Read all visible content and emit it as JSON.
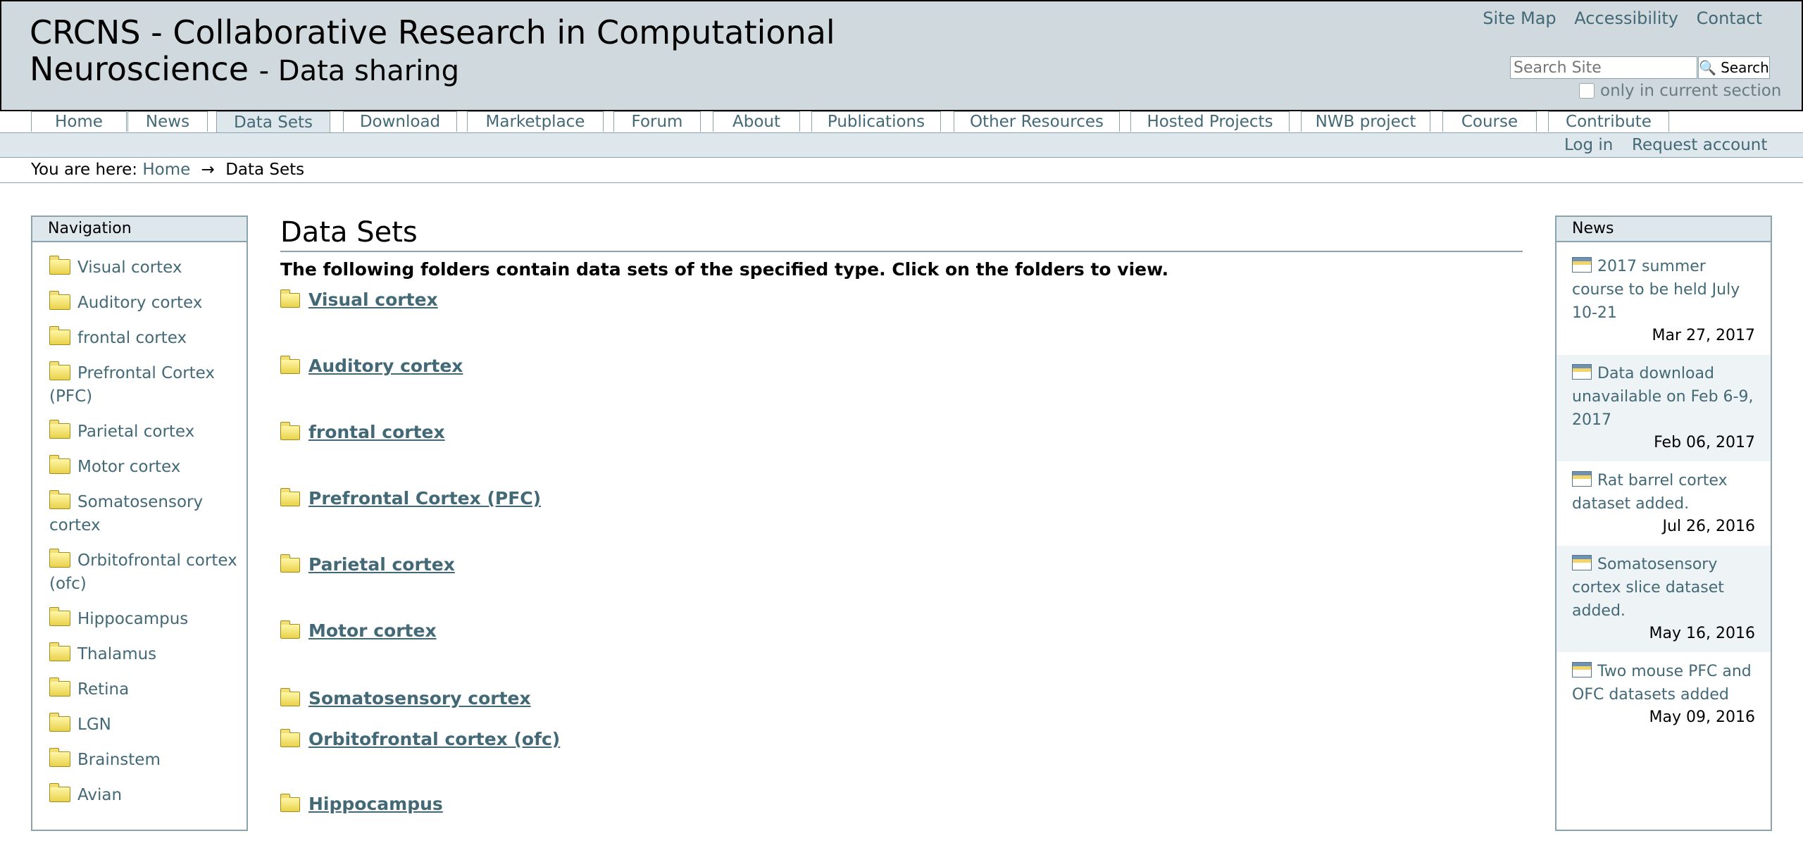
{
  "header": {
    "title_main": "CRCNS - Collaborative Research in Computational Neuroscience",
    "title_sub": "- Data sharing",
    "site_actions": [
      "Site Map",
      "Accessibility",
      "Contact"
    ],
    "search_placeholder": "Search Site",
    "search_button": "Search",
    "search_section_label": "only in current section"
  },
  "tabs": [
    "Home",
    "News",
    "Data Sets",
    "Download",
    "Marketplace",
    "Forum",
    "About",
    "Publications",
    "Other Resources",
    "Hosted Projects",
    "NWB project",
    "Course",
    "Contribute"
  ],
  "personal_bar": {
    "login": "Log in",
    "request": "Request account"
  },
  "breadcrumbs": {
    "prefix": "You are here:",
    "home": "Home",
    "separator": "→",
    "current": "Data Sets"
  },
  "navigation": {
    "header": "Navigation",
    "items": [
      "Visual cortex",
      "Auditory cortex",
      "frontal cortex",
      "Prefrontal Cortex (PFC)",
      "Parietal cortex",
      "Motor cortex",
      "Somatosensory cortex",
      "Orbitofrontal cortex (ofc)",
      "Hippocampus",
      "Thalamus",
      "Retina",
      "LGN",
      "Brainstem",
      "Avian"
    ]
  },
  "content": {
    "title": "Data Sets",
    "description": "The following folders contain data sets of the specified type. Click on the folders to view.",
    "folders": [
      "Visual cortex",
      "Auditory cortex",
      "frontal cortex",
      "Prefrontal Cortex (PFC)",
      "Parietal cortex",
      "Motor cortex",
      "Somatosensory cortex",
      "Orbitofrontal cortex (ofc)",
      "Hippocampus"
    ]
  },
  "news": {
    "header": "News",
    "items": [
      {
        "title": "2017 summer course to be held July 10-21",
        "date": "Mar 27, 2017"
      },
      {
        "title": "Data download unavailable on Feb 6-9, 2017",
        "date": "Feb 06, 2017"
      },
      {
        "title": "Rat barrel cortex dataset added.",
        "date": "Jul 26, 2016"
      },
      {
        "title": "Somatosensory cortex slice dataset added.",
        "date": "May 16, 2016"
      },
      {
        "title": "Two mouse PFC and OFC datasets added",
        "date": "May 09, 2016"
      }
    ]
  }
}
